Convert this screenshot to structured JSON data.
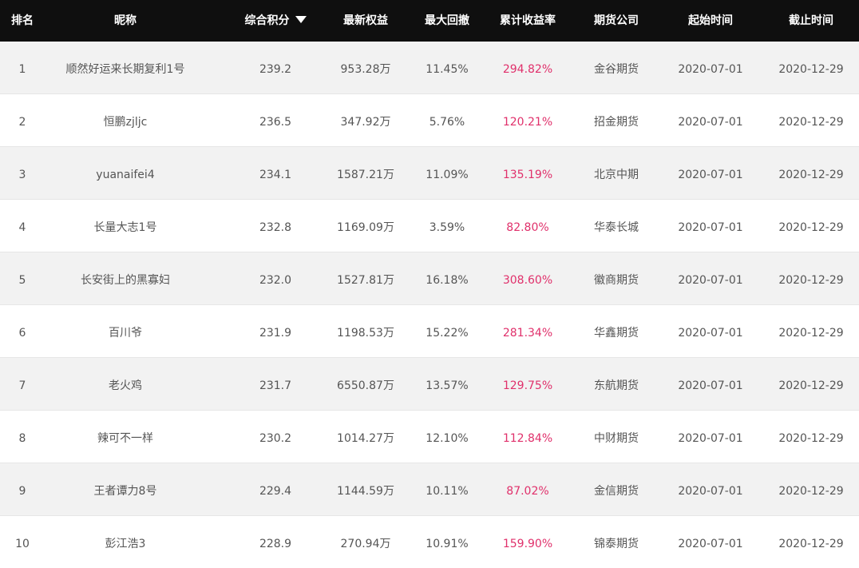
{
  "columns": {
    "rank": "排名",
    "name": "昵称",
    "score": "综合积分",
    "equity": "最新权益",
    "drawdown": "最大回撤",
    "return": "累计收益率",
    "firm": "期货公司",
    "start": "起始时间",
    "end": "截止时间"
  },
  "sort_icon": "triangle-down-icon",
  "colors": {
    "header_bg": "#0f0f0f",
    "return_text": "#e0306b",
    "row_alt": "#f2f2f2"
  },
  "rows": [
    {
      "rank": "1",
      "name": "顺然好运来长期复利1号",
      "score": "239.2",
      "equity": "953.28万",
      "drawdown": "11.45%",
      "return": "294.82%",
      "firm": "金谷期货",
      "start": "2020-07-01",
      "end": "2020-12-29"
    },
    {
      "rank": "2",
      "name": "恒鹏zjljc",
      "score": "236.5",
      "equity": "347.92万",
      "drawdown": "5.76%",
      "return": "120.21%",
      "firm": "招金期货",
      "start": "2020-07-01",
      "end": "2020-12-29"
    },
    {
      "rank": "3",
      "name": "yuanaifei4",
      "score": "234.1",
      "equity": "1587.21万",
      "drawdown": "11.09%",
      "return": "135.19%",
      "firm": "北京中期",
      "start": "2020-07-01",
      "end": "2020-12-29"
    },
    {
      "rank": "4",
      "name": "长量大志1号",
      "score": "232.8",
      "equity": "1169.09万",
      "drawdown": "3.59%",
      "return": "82.80%",
      "firm": "华泰长城",
      "start": "2020-07-01",
      "end": "2020-12-29"
    },
    {
      "rank": "5",
      "name": "长安街上的黑寡妇",
      "score": "232.0",
      "equity": "1527.81万",
      "drawdown": "16.18%",
      "return": "308.60%",
      "firm": "徽商期货",
      "start": "2020-07-01",
      "end": "2020-12-29"
    },
    {
      "rank": "6",
      "name": "百川爷",
      "score": "231.9",
      "equity": "1198.53万",
      "drawdown": "15.22%",
      "return": "281.34%",
      "firm": "华鑫期货",
      "start": "2020-07-01",
      "end": "2020-12-29"
    },
    {
      "rank": "7",
      "name": "老火鸡",
      "score": "231.7",
      "equity": "6550.87万",
      "drawdown": "13.57%",
      "return": "129.75%",
      "firm": "东航期货",
      "start": "2020-07-01",
      "end": "2020-12-29"
    },
    {
      "rank": "8",
      "name": "辣可不一样",
      "score": "230.2",
      "equity": "1014.27万",
      "drawdown": "12.10%",
      "return": "112.84%",
      "firm": "中财期货",
      "start": "2020-07-01",
      "end": "2020-12-29"
    },
    {
      "rank": "9",
      "name": "王者谭力8号",
      "score": "229.4",
      "equity": "1144.59万",
      "drawdown": "10.11%",
      "return": "87.02%",
      "firm": "金信期货",
      "start": "2020-07-01",
      "end": "2020-12-29"
    },
    {
      "rank": "10",
      "name": "彭江浩3",
      "score": "228.9",
      "equity": "270.94万",
      "drawdown": "10.91%",
      "return": "159.90%",
      "firm": "锦泰期货",
      "start": "2020-07-01",
      "end": "2020-12-29"
    }
  ]
}
